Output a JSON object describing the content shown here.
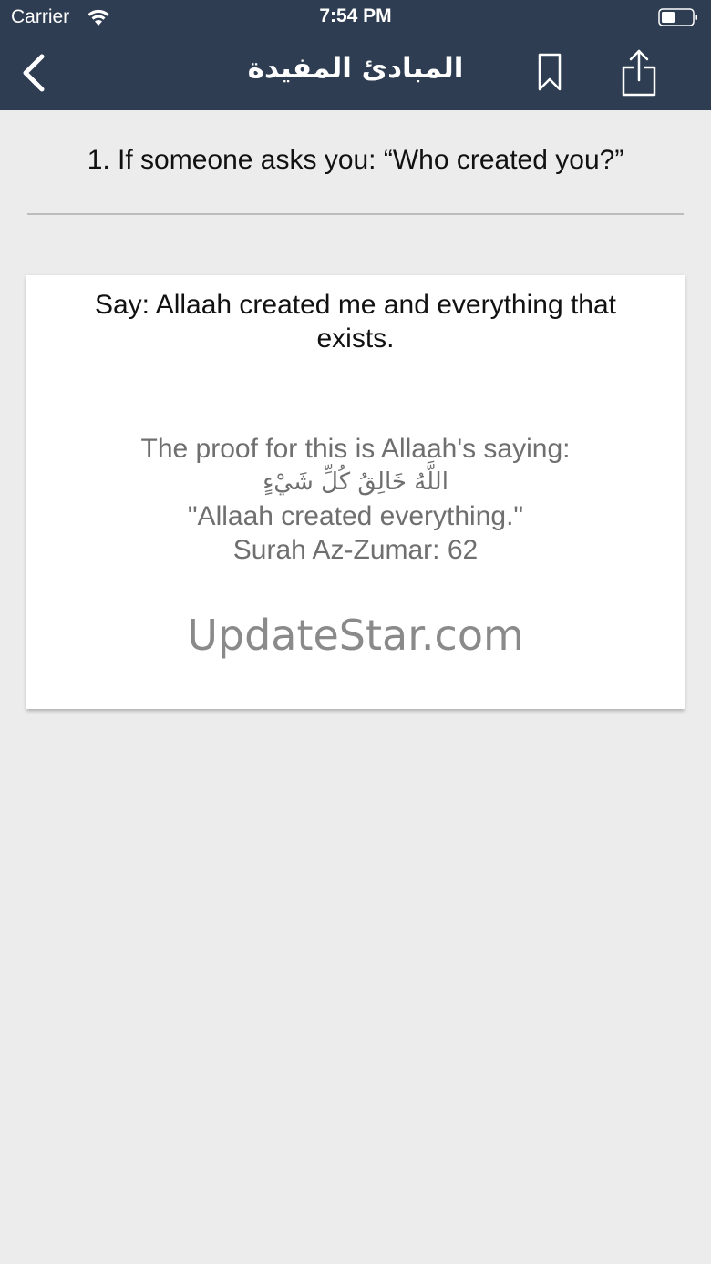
{
  "status_bar": {
    "carrier": "Carrier",
    "time": "7:54 PM"
  },
  "nav": {
    "title": "المبادئ المفيدة",
    "back_icon": "chevron-left-icon",
    "bookmark_icon": "bookmark-icon",
    "share_icon": "share-icon"
  },
  "question": "1. If someone asks you: “Who created you?”",
  "card": {
    "answer": "Say: Allaah created me and everything that exists.",
    "proof_intro": "The proof for this is Allaah's saying:",
    "arabic_verse": "اللَّهُ خَالِقُ كُلِّ شَيْءٍ",
    "translation": "\"Allaah created everything.\"",
    "reference": "Surah Az-Zumar: 62"
  },
  "watermark": "UpdateStar.com",
  "colors": {
    "header_bg": "#2e3d52",
    "page_bg": "#ececec",
    "card_bg": "#ffffff",
    "proof_text": "#6f6f6f"
  }
}
